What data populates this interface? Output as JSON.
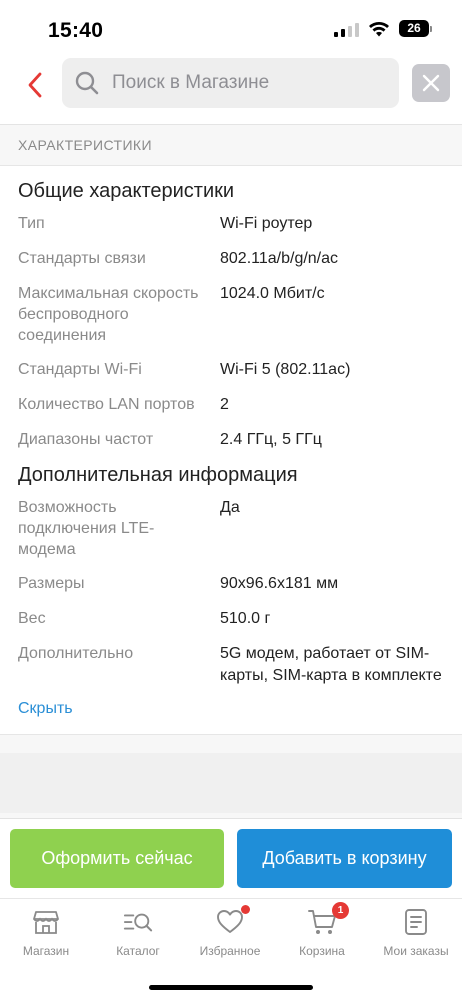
{
  "status_bar": {
    "time": "15:40",
    "battery": "26",
    "icons": [
      "signal-icon",
      "wifi-icon",
      "battery-icon"
    ]
  },
  "search": {
    "placeholder": "Поиск в Магазине",
    "value": "",
    "icons": [
      "back-arrow-icon",
      "search-icon",
      "close-icon"
    ]
  },
  "specs": {
    "section_title": "ХАРАКТЕРИСТИКИ",
    "general_title": "Общие характеристики",
    "general_rows": [
      {
        "label": "Тип",
        "value": "Wi-Fi роутер"
      },
      {
        "label": "Стандарты связи",
        "value": "802.11a/b/g/n/ac"
      },
      {
        "label": "Максимальная скорость беспроводного соединения",
        "value": "1024.0 Мбит/с"
      },
      {
        "label": "Стандарты Wi-Fi",
        "value": "Wi-Fi 5 (802.11ac)"
      },
      {
        "label": "Количество LAN портов",
        "value": "2"
      },
      {
        "label": "Диапазоны частот",
        "value": "2.4 ГГц, 5 ГГц"
      }
    ],
    "extra_title": "Дополнительная информация",
    "extra_rows": [
      {
        "label": "Возможность подключения LTE-модема",
        "value": "Да"
      },
      {
        "label": "Размеры",
        "value": "90x96.6x181 мм"
      },
      {
        "label": "Вес",
        "value": "510.0 г"
      },
      {
        "label": "Дополнительно",
        "value": "5G модем, работает от SIM-карты, SIM-карта в комплекте"
      }
    ],
    "hide_link": "Скрыть"
  },
  "actions": {
    "checkout": "Оформить сейчас",
    "add_to_cart": "Добавить в корзину",
    "checkout_color": "#8fd14f",
    "cart_color": "#1f8ed8"
  },
  "tabs": [
    {
      "label": "Магазин",
      "icon": "store-icon"
    },
    {
      "label": "Каталог",
      "icon": "catalog-search-icon"
    },
    {
      "label": "Избранное",
      "icon": "heart-icon",
      "dot": true
    },
    {
      "label": "Корзина",
      "icon": "cart-icon",
      "badge": "1"
    },
    {
      "label": "Мои заказы",
      "icon": "orders-icon"
    }
  ],
  "colors": {
    "accent_red": "#e53935",
    "link_blue": "#2b8fd6"
  }
}
